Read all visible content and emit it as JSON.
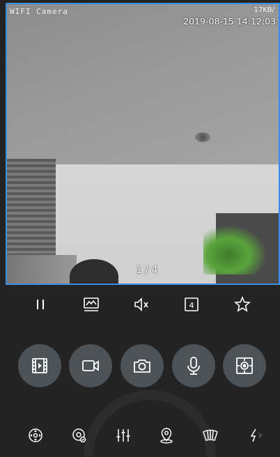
{
  "video": {
    "camera_name": "WIFI Camera",
    "bitrate": "17KB/",
    "timestamp": "2019-08-15 14:12:03",
    "page_indicator": "1 / 4",
    "border_color": "#3a8ee6"
  },
  "toolbar": {
    "icons": [
      "pause-icon",
      "image-quality-icon",
      "mute-icon",
      "split-screen-icon",
      "favorite-icon"
    ],
    "split_count": "4"
  },
  "controls": {
    "icons": [
      "playback-icon",
      "record-icon",
      "snapshot-icon",
      "microphone-icon",
      "ptz-icon"
    ],
    "button_color": "#4b5258"
  },
  "bottombar": {
    "icons": [
      "ptz-control-icon",
      "cruise-icon",
      "image-adjust-icon",
      "preset-icon",
      "fisheye-icon",
      "flash-icon",
      "chevron-right-icon"
    ]
  },
  "colors": {
    "background": "#232323",
    "icon": "#ffffff"
  }
}
